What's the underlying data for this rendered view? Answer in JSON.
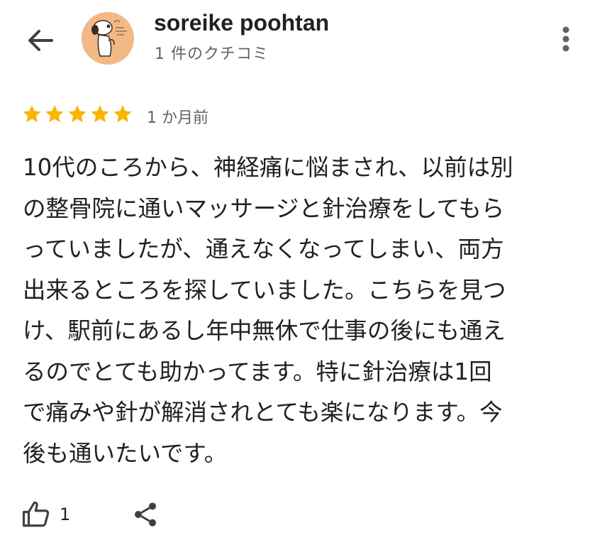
{
  "header": {
    "back_icon": "arrow-left-icon",
    "author_name": "soreike poohtan",
    "review_count": "1 件のクチコミ",
    "more_icon": "more-vertical-icon"
  },
  "review": {
    "rating": 5,
    "max_rating": 5,
    "star_color": "#f9b500",
    "date": "1 か月前",
    "lines": [
      "10代のころから、神経痛に悩まされ、以前は別",
      "の整骨院に通いマッサージと針治療をしてもら",
      "っていましたが、通えなくなってしまい、両方",
      "出来るところを探していました。こちらを見つ",
      "け、駅前にあるし年中無休で仕事の後にも通え",
      "るのでとても助かってます。特に針治療は1回",
      "で痛みや針が解消されとても楽になります。今",
      "後も通いたいです。"
    ]
  },
  "actions": {
    "like_icon": "thumbs-up-icon",
    "like_count": "1",
    "share_icon": "share-icon"
  }
}
